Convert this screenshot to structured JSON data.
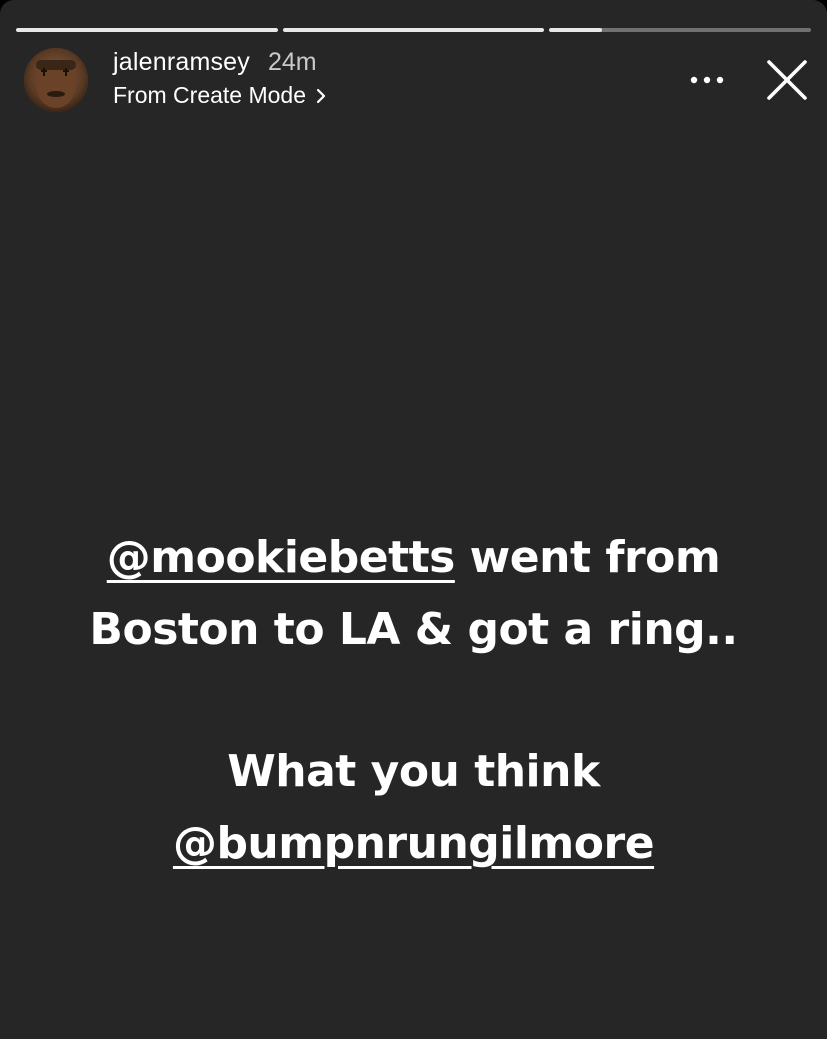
{
  "progress": {
    "segments": [
      {
        "fill": 1.0
      },
      {
        "fill": 1.0
      },
      {
        "fill": 0.2
      }
    ]
  },
  "header": {
    "username": "jalenramsey",
    "time_ago": "24m",
    "subtitle": "From Create Mode",
    "avatar_icon": "profile-photo",
    "more_icon": "more-horizontal-icon",
    "close_icon": "close-icon"
  },
  "story": {
    "line1_mention": "@mookiebetts",
    "line1_rest": " went from",
    "line2": "Boston to LA & got a ring..",
    "line3": "What you think",
    "line4_mention": "@bumpnrungilmore"
  },
  "colors": {
    "background": "#262626",
    "text": "#ffffff",
    "progress_track": "rgba(255,255,255,0.35)",
    "progress_fill": "#e8e8e8"
  }
}
